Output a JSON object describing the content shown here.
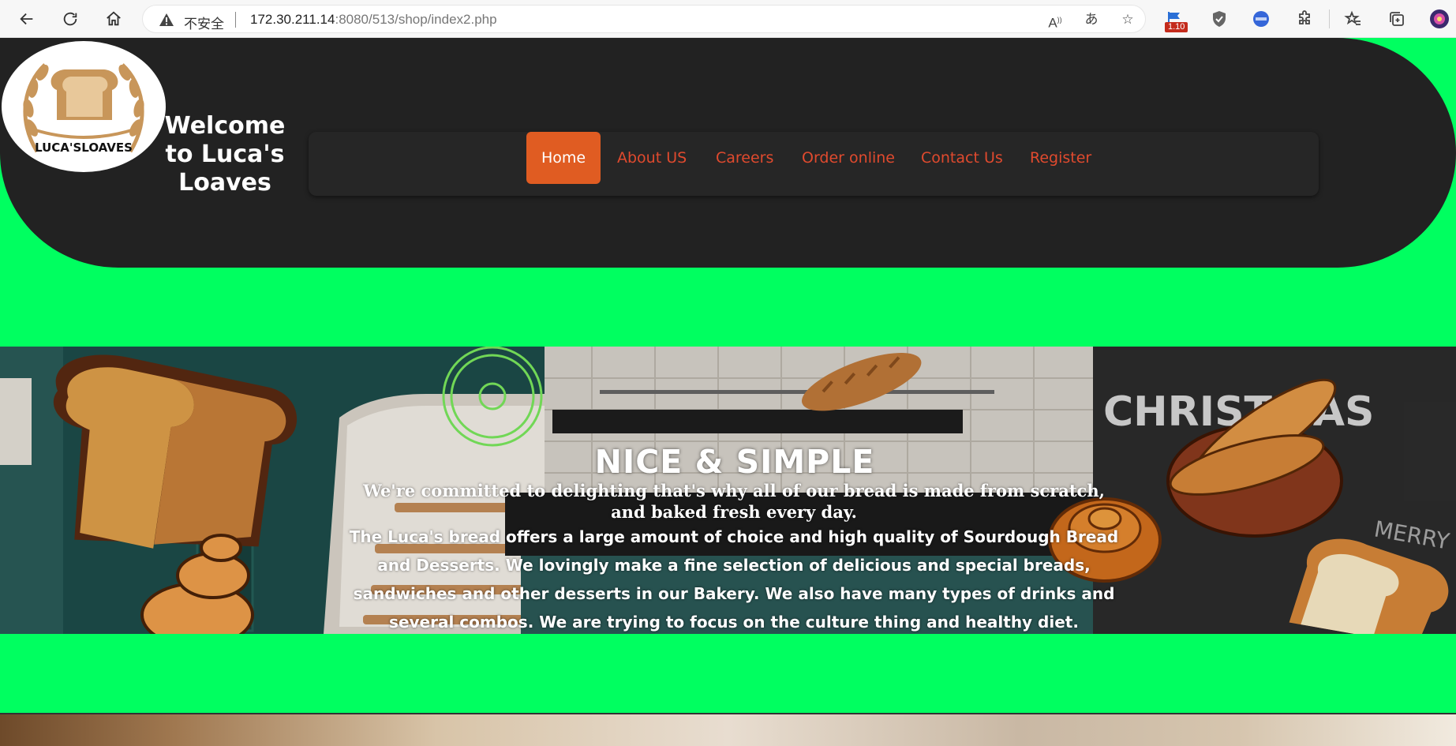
{
  "browser": {
    "insecure_label": "不安全",
    "url_host": "172.30.211.14",
    "url_rest": ":8080/513/shop/index2.php",
    "badge": "1.10"
  },
  "header": {
    "logo_text": "LUCA'SLOAVES",
    "welcome": "Welcome to Luca's Loaves",
    "nav": [
      "Home",
      "About US",
      "Careers",
      "Order online",
      "Contact Us",
      "Register"
    ]
  },
  "banner": {
    "title": "NICE & SIMPLE",
    "subtitle": "We're committed to delighting that's why all of our bread is made from scratch, and baked fresh every day.",
    "description": "The Luca's bread offers a large amount of choice and high quality of Sourdough Bread and Desserts. We lovingly make a fine selection of delicious and special breads, sandwiches and other desserts in our Bakery. We also have many types of drinks and several combos. We are trying to focus on the culture thing and healthy diet.",
    "chalk_text_1": "CHRISTMAS",
    "chalk_text_2": "MERRY CHRISTMAS"
  },
  "colors": {
    "page_bg": "#00ff60",
    "header_bg": "#222222",
    "nav_active": "#e05c22",
    "nav_link": "#e04a2e"
  }
}
